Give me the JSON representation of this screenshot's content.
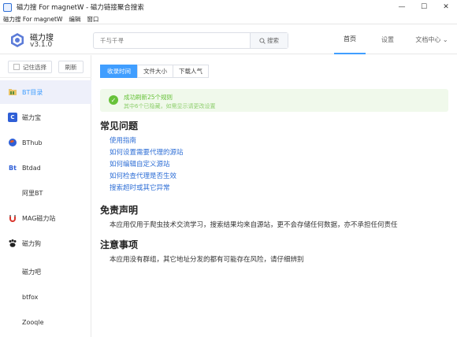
{
  "window": {
    "title": "磁力搜 For magnetW - 磁力链接聚合搜索",
    "minimize_glyph": "—",
    "maximize_glyph": "☐",
    "close_glyph": "✕"
  },
  "menu": {
    "items": [
      "磁力搜 For magnetW",
      "编辑",
      "窗口"
    ]
  },
  "app": {
    "name": "磁力搜",
    "version": "v3.1.0"
  },
  "search": {
    "placeholder": "千与千寻",
    "button_label": "搜索"
  },
  "nav": {
    "items": [
      "首页",
      "设置",
      "文档中心 ⌄"
    ],
    "active_index": 0
  },
  "sidebar": {
    "remember_label": "记住选择",
    "refresh_label": "刷新",
    "sites": [
      {
        "label": "BT目录",
        "icon": "bt-folder-icon",
        "active": true
      },
      {
        "label": "磁力宝",
        "icon": "c-letter-icon"
      },
      {
        "label": "BThub",
        "icon": "globe-icon"
      },
      {
        "label": "Btdad",
        "icon": "bt-letter-icon"
      },
      {
        "label": "阿里BT",
        "icon": ""
      },
      {
        "label": "MAG磁力站",
        "icon": "magnet-icon"
      },
      {
        "label": "磁力狗",
        "icon": "paw-icon"
      },
      {
        "label": "磁力吧",
        "icon": ""
      },
      {
        "label": "btfox",
        "icon": ""
      },
      {
        "label": "Zooqle",
        "icon": ""
      }
    ]
  },
  "main": {
    "sort_tabs": [
      "收录时间",
      "文件大小",
      "下载人气"
    ],
    "active_sort": 0,
    "alert": {
      "title": "成功刷新25个规则",
      "description": "其中6个已隐藏，如需显示请更改设置"
    },
    "faq_title": "常见问题",
    "faq_links": [
      "使用指南",
      "如何设置需要代理的源站",
      "如何编辑自定义源站",
      "如何检查代理是否生效",
      "搜索超时或其它异常"
    ],
    "disclaimer_title": "免责声明",
    "disclaimer_text": "本应用仅用于爬虫技术交流学习，搜索结果均来自源站，更不会存储任何数据，亦不承担任何责任",
    "notice_title": "注意事项",
    "notice_text": "本应用没有群组，其它地址分发的都有可能存在风险，请仔细辨别"
  },
  "colors": {
    "accent": "#409eff",
    "success": "#67c23a",
    "link": "#2f6fd6"
  }
}
